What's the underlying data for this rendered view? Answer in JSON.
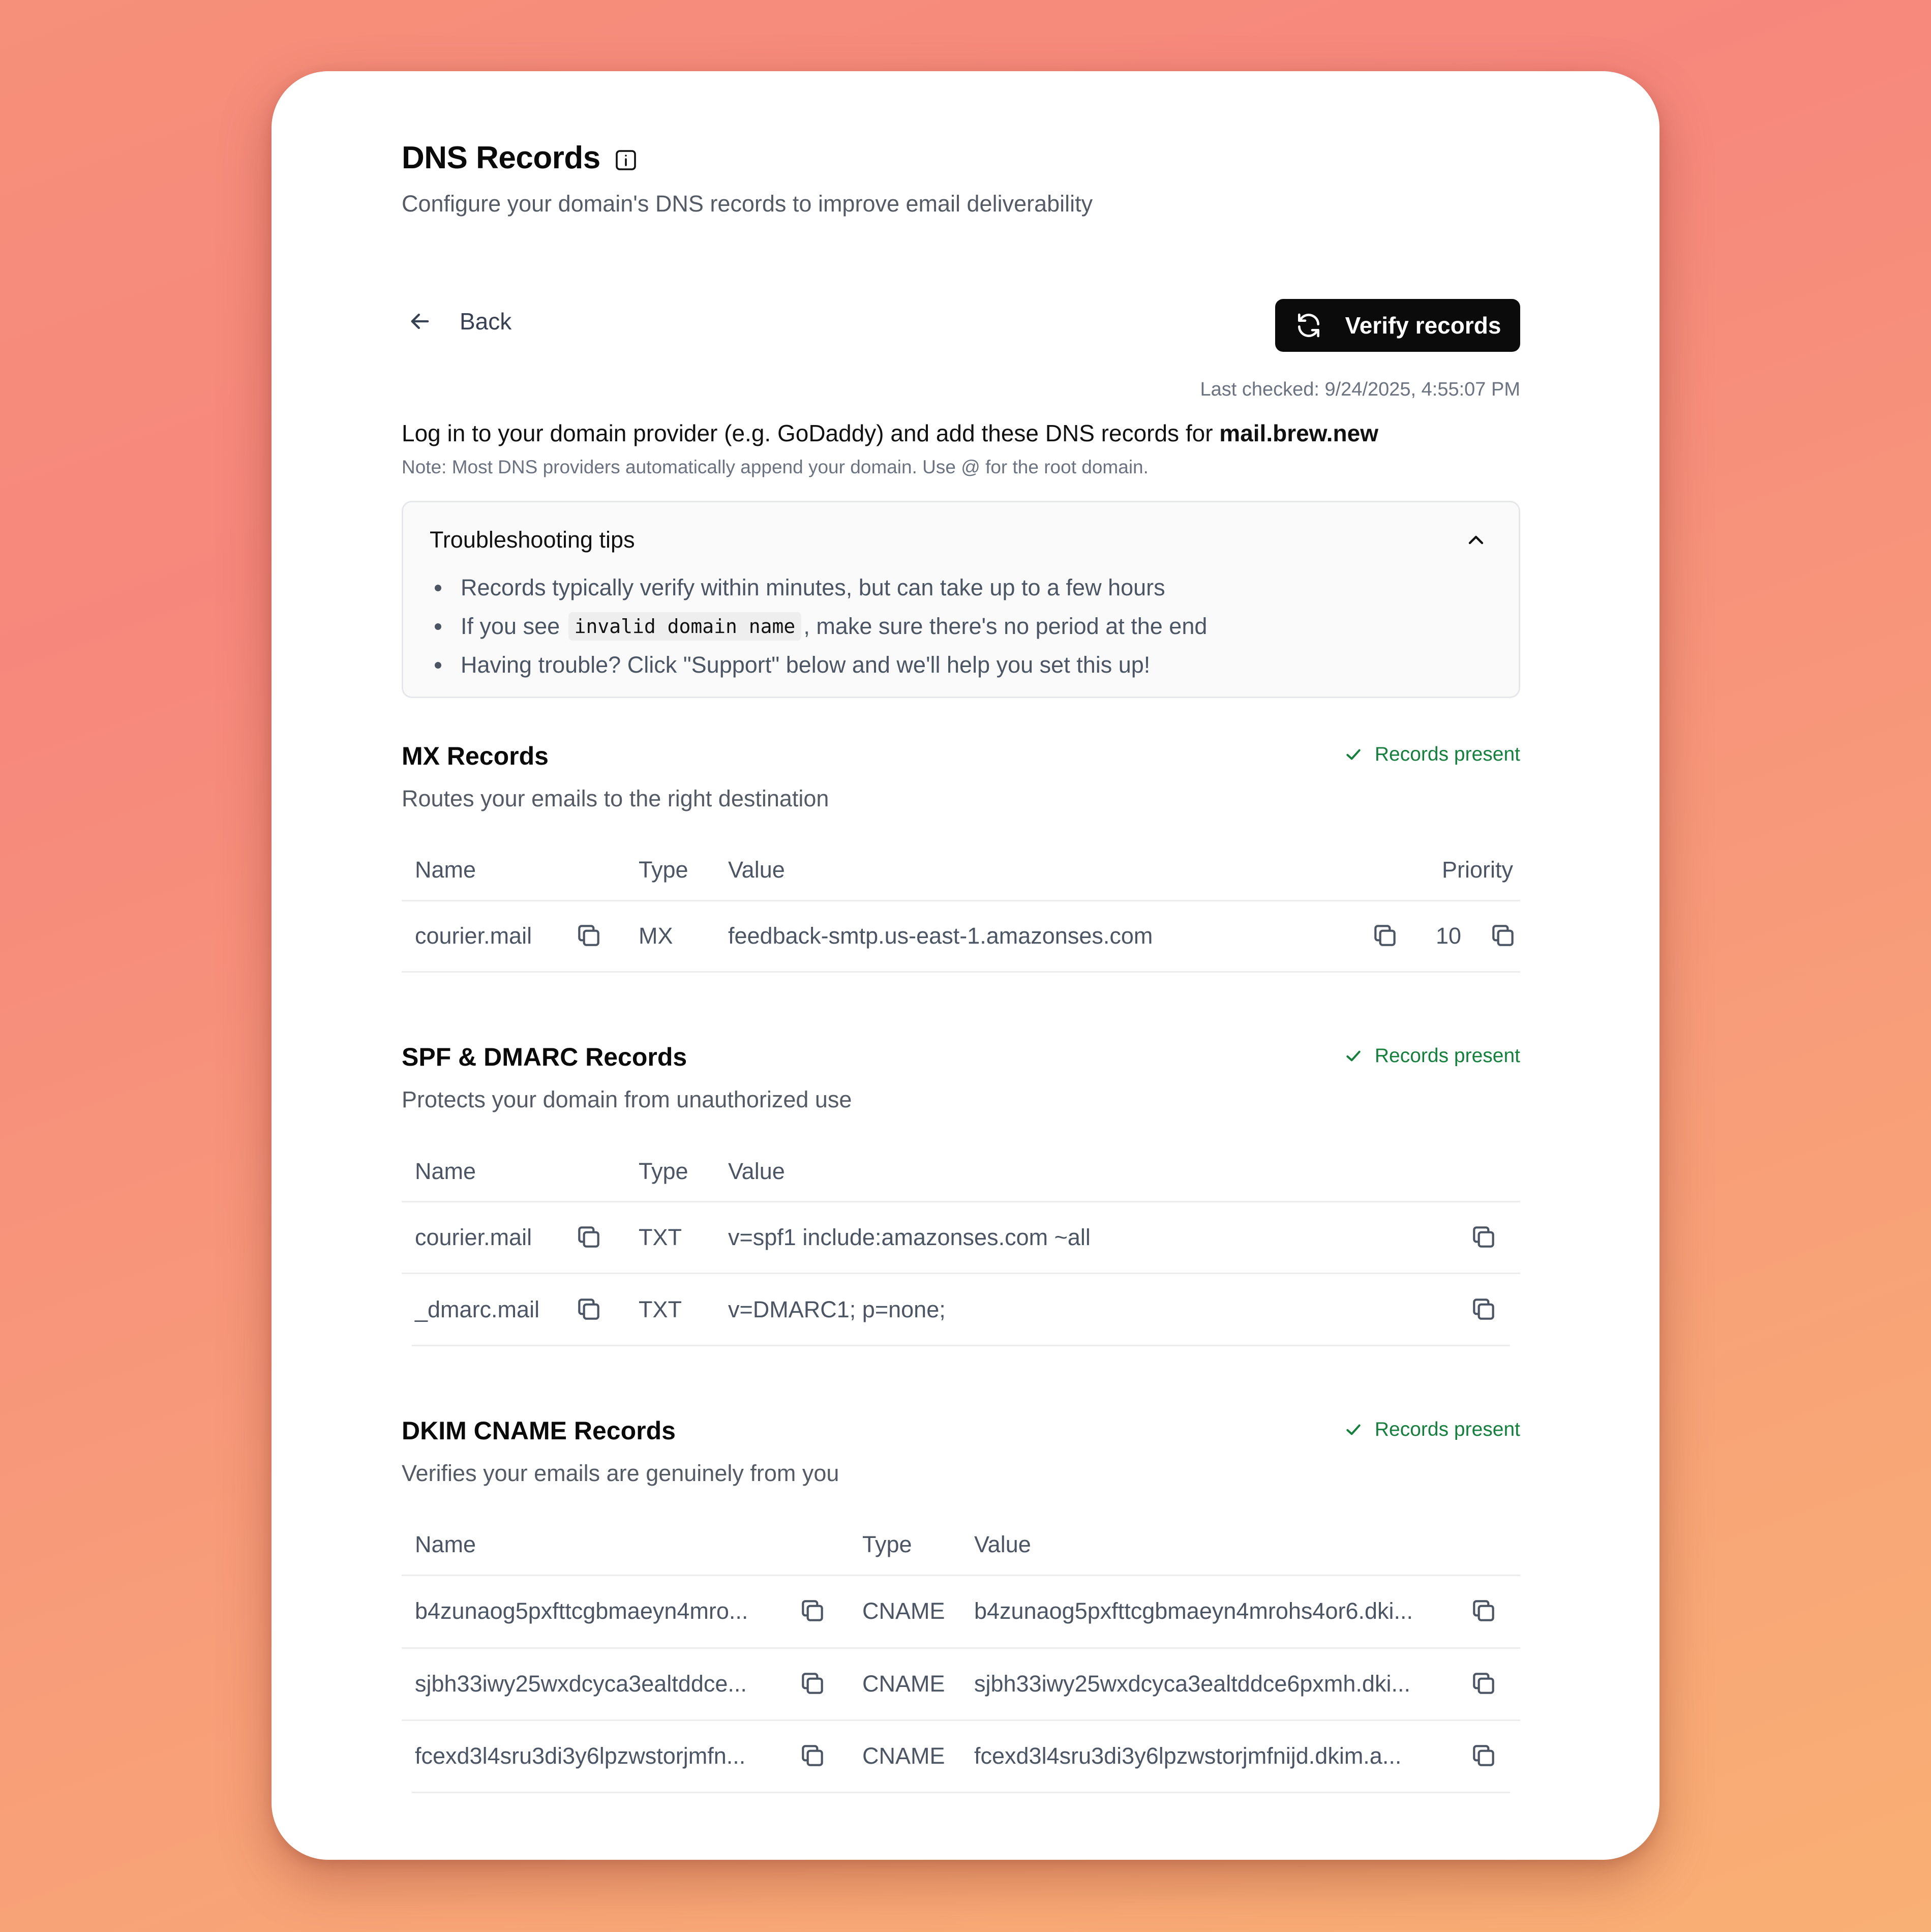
{
  "header": {
    "title": "DNS Records",
    "subtitle": "Configure your domain's DNS records to improve email deliverability"
  },
  "nav": {
    "back_label": "Back",
    "verify_label": "Verify records",
    "last_checked": "Last checked: 9/24/2025, 4:55:07 PM"
  },
  "instruction": {
    "text": "Log in to your domain provider (e.g. GoDaddy) and add these DNS records for ",
    "domain": "mail.brew.new",
    "note": "Note: Most DNS providers automatically append your domain. Use @ for the root domain."
  },
  "tips": {
    "title": "Troubleshooting tips",
    "item1": "Records typically verify within minutes, but can take up to a few hours",
    "item2_pre": "If you see ",
    "item2_code": "invalid domain name",
    "item2_post": ", make sure there's no period at the end",
    "item3": "Having trouble? Click \"Support\" below and we'll help you set this up!"
  },
  "mx": {
    "title": "MX Records",
    "subtitle": "Routes your emails to the right destination",
    "status": "Records present",
    "headers": {
      "name": "Name",
      "type": "Type",
      "value": "Value",
      "priority": "Priority"
    },
    "rows": [
      {
        "name": "courier.mail",
        "type": "MX",
        "value": "feedback-smtp.us-east-1.amazonses.com",
        "priority": "10"
      }
    ]
  },
  "spf": {
    "title": "SPF & DMARC Records",
    "subtitle": "Protects your domain from unauthorized use",
    "status": "Records present",
    "headers": {
      "name": "Name",
      "type": "Type",
      "value": "Value"
    },
    "rows": [
      {
        "name": "courier.mail",
        "type": "TXT",
        "value": "v=spf1 include:amazonses.com ~all"
      },
      {
        "name": "_dmarc.mail",
        "type": "TXT",
        "value": "v=DMARC1; p=none;"
      }
    ]
  },
  "dkim": {
    "title": "DKIM CNAME Records",
    "subtitle": "Verifies your emails are genuinely from you",
    "status": "Records present",
    "headers": {
      "name": "Name",
      "type": "Type",
      "value": "Value"
    },
    "rows": [
      {
        "name": "b4zunaog5pxfttcgbmaeyn4mro...",
        "type": "CNAME",
        "value": "b4zunaog5pxfttcgbmaeyn4mrohs4or6.dki..."
      },
      {
        "name": "sjbh33iwy25wxdcyca3ealtddce...",
        "type": "CNAME",
        "value": "sjbh33iwy25wxdcyca3ealtddce6pxmh.dki..."
      },
      {
        "name": "fcexd3l4sru3di3y6lpzwstorjmfn...",
        "type": "CNAME",
        "value": "fcexd3l4sru3di3y6lpzwstorjmfnijd.dkim.a..."
      }
    ]
  },
  "icons": {
    "info": "info-icon",
    "back": "arrow-left-icon",
    "refresh": "refresh-icon",
    "chevron": "chevron-up-icon",
    "check": "check-icon",
    "copy": "copy-icon"
  },
  "colors": {
    "primary_button": "#0b0b0b",
    "success": "#15803d",
    "muted_text": "#6b7280"
  }
}
